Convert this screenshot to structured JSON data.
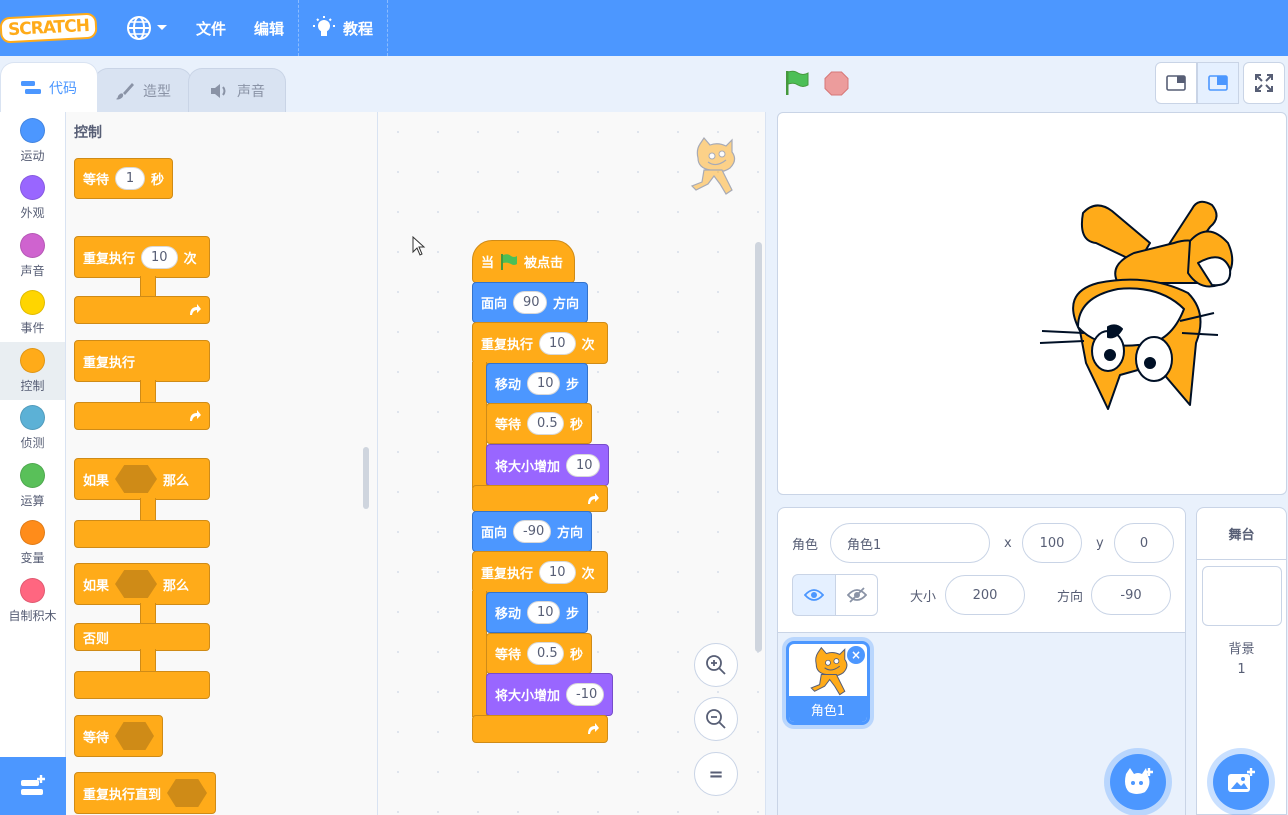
{
  "menubar": {
    "logo_text": "SCRATCH",
    "file": "文件",
    "edit": "编辑",
    "tutorials": "教程"
  },
  "tabs": {
    "code": "代码",
    "costumes": "造型",
    "sounds": "声音"
  },
  "categories": [
    {
      "label": "运动",
      "color": "#4c97ff"
    },
    {
      "label": "外观",
      "color": "#9966ff"
    },
    {
      "label": "声音",
      "color": "#cf63cf"
    },
    {
      "label": "事件",
      "color": "#ffd500"
    },
    {
      "label": "控制",
      "color": "#ffab19"
    },
    {
      "label": "侦测",
      "color": "#5cb1d6"
    },
    {
      "label": "运算",
      "color": "#59c059"
    },
    {
      "label": "变量",
      "color": "#ff8c1a"
    },
    {
      "label": "自制积木",
      "color": "#ff6680"
    }
  ],
  "palette": {
    "title": "控制",
    "wait": {
      "label": "等待",
      "value": "1",
      "unit": "秒"
    },
    "repeat": {
      "label": "重复执行",
      "value": "10",
      "unit": "次"
    },
    "forever": {
      "label": "重复执行"
    },
    "if_then": {
      "label": "如果",
      "then": "那么"
    },
    "if_else": {
      "label": "如果",
      "then": "那么",
      "else": "否则"
    },
    "wait_until": {
      "label": "等待"
    },
    "repeat_until": {
      "label": "重复执行直到"
    }
  },
  "script": {
    "hat": {
      "pre": "当",
      "post": "被点击"
    },
    "point1": {
      "label": "面向",
      "value": "90",
      "unit": "方向"
    },
    "repeat1": {
      "label": "重复执行",
      "value": "10",
      "unit": "次"
    },
    "move1": {
      "label": "移动",
      "value": "10",
      "unit": "步"
    },
    "wait1": {
      "label": "等待",
      "value": "0.5",
      "unit": "秒"
    },
    "size1": {
      "label": "将大小增加",
      "value": "10"
    },
    "point2": {
      "label": "面向",
      "value": "-90",
      "unit": "方向"
    },
    "repeat2": {
      "label": "重复执行",
      "value": "10",
      "unit": "次"
    },
    "move2": {
      "label": "移动",
      "value": "10",
      "unit": "步"
    },
    "wait2": {
      "label": "等待",
      "value": "0.5",
      "unit": "秒"
    },
    "size2": {
      "label": "将大小增加",
      "value": "-10"
    }
  },
  "zoom": {
    "reset": "="
  },
  "sprite_info": {
    "sprite_label": "角色",
    "sprite_name": "角色1",
    "x_label": "x",
    "x": "100",
    "y_label": "y",
    "y": "0",
    "size_label": "大小",
    "size": "200",
    "direction_label": "方向",
    "direction": "-90"
  },
  "sprites": [
    {
      "name": "角色1",
      "selected": true
    }
  ],
  "stage_pane": {
    "title": "舞台",
    "backdrops_label": "背景",
    "backdrops_count": "1"
  }
}
